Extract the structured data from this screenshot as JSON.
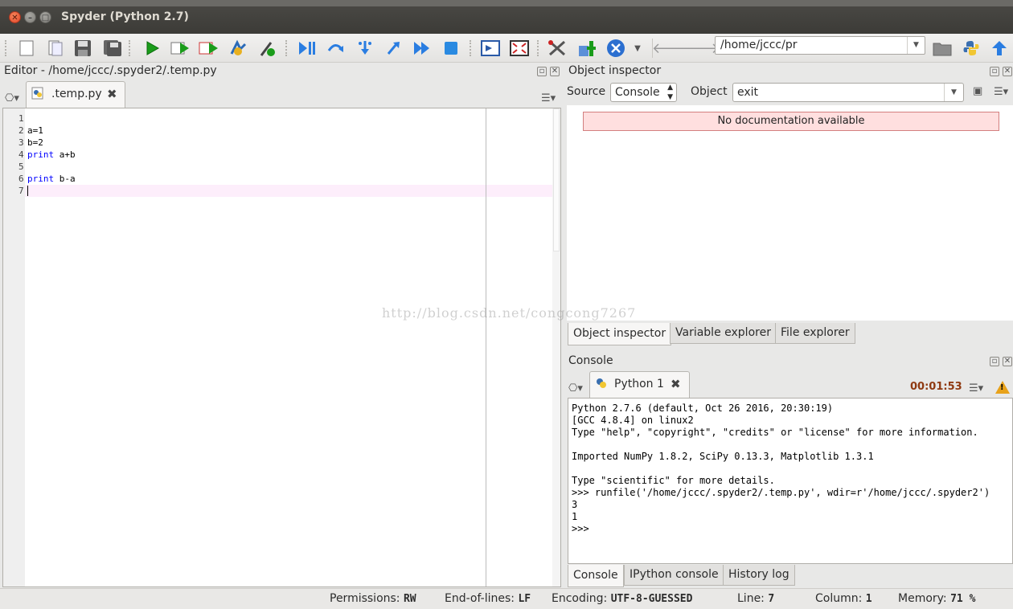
{
  "window": {
    "title": "Spyder (Python 2.7)"
  },
  "toolbar": {
    "icons": [
      "new-file-icon",
      "open-file-icon",
      "save-icon",
      "save-all-icon",
      "run-icon",
      "run-selection-icon",
      "run-config-icon",
      "debug-icon",
      "configure-icon",
      "debug-step-icon",
      "step-over-icon",
      "step-into-icon",
      "step-return-icon",
      "continue-icon",
      "stop-icon",
      "maximize-pane-icon",
      "fullscreen-icon",
      "tools-icon",
      "python-path-icon",
      "close-icon",
      "back-arrow-icon",
      "forward-arrow-icon",
      "browse-folder-icon",
      "python-icon",
      "up-arrow-icon"
    ],
    "path_value": "/home/jccc/pr"
  },
  "editor": {
    "pane_title": "Editor - /home/jccc/.spyder2/.temp.py",
    "tab_label": ".temp.py",
    "lines": [
      {
        "n": "1",
        "text": ""
      },
      {
        "n": "2",
        "text": "a=1"
      },
      {
        "n": "3",
        "text": "b=2"
      },
      {
        "n": "4",
        "kw": "print",
        "text": " a+b"
      },
      {
        "n": "5",
        "text": ""
      },
      {
        "n": "6",
        "kw": "print",
        "text": " b-a"
      },
      {
        "n": "7",
        "text": ""
      }
    ]
  },
  "object_inspector": {
    "pane_title": "Object inspector",
    "source_label": "Source",
    "source_value": "Console",
    "object_label": "Object",
    "object_value": "exit",
    "message": "No documentation available",
    "tabs": [
      "Object inspector",
      "Variable explorer",
      "File explorer"
    ]
  },
  "watermark": "http://blog.csdn.net/congcong7267",
  "console": {
    "pane_title": "Console",
    "tab_label": "Python 1",
    "timer": "00:01:53",
    "lines": [
      "Python 2.7.6 (default, Oct 26 2016, 20:30:19)",
      "[GCC 4.8.4] on linux2",
      "Type \"help\", \"copyright\", \"credits\" or \"license\" for more information.",
      "",
      "Imported NumPy 1.8.2, SciPy 0.13.3, Matplotlib 1.3.1",
      "",
      "Type \"scientific\" for more details.",
      ">>> runfile('/home/jccc/.spyder2/.temp.py', wdir=r'/home/jccc/.spyder2')",
      "3",
      "1",
      ">>> "
    ],
    "tabs": [
      "Console",
      "IPython console",
      "History log"
    ]
  },
  "status": {
    "permissions_label": "Permissions:",
    "permissions_value": "RW",
    "eol_label": "End-of-lines:",
    "eol_value": "LF",
    "encoding_label": "Encoding:",
    "encoding_value": "UTF-8-GUESSED",
    "line_label": "Line:",
    "line_value": "7",
    "column_label": "Column:",
    "column_value": "1",
    "memory_label": "Memory:",
    "memory_value": "71 %"
  },
  "colors": {
    "titlebar": "#3c3b37",
    "current_line": "#fdeefb",
    "keyword": "#0000ff",
    "nodoc_bg": "#ffdfdf",
    "timer": "#8f3a12"
  }
}
